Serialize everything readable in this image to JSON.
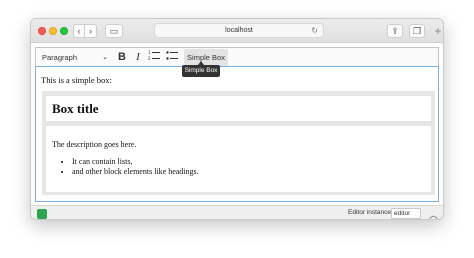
{
  "browser": {
    "url": "localhost"
  },
  "toolbar": {
    "heading": "Paragraph",
    "bold_label": "B",
    "italic_label": "I",
    "simple_box_label": "Simple Box",
    "tooltip": "Simple Box"
  },
  "content": {
    "intro": "This is a simple box:",
    "box_title": "Box title",
    "box_description": "The description goes here.",
    "list_items": [
      "It can contain lists,",
      "and other block elements like headings."
    ]
  },
  "statusbar": {
    "instance_label": "Editor instance:",
    "instance_value": "editor"
  }
}
